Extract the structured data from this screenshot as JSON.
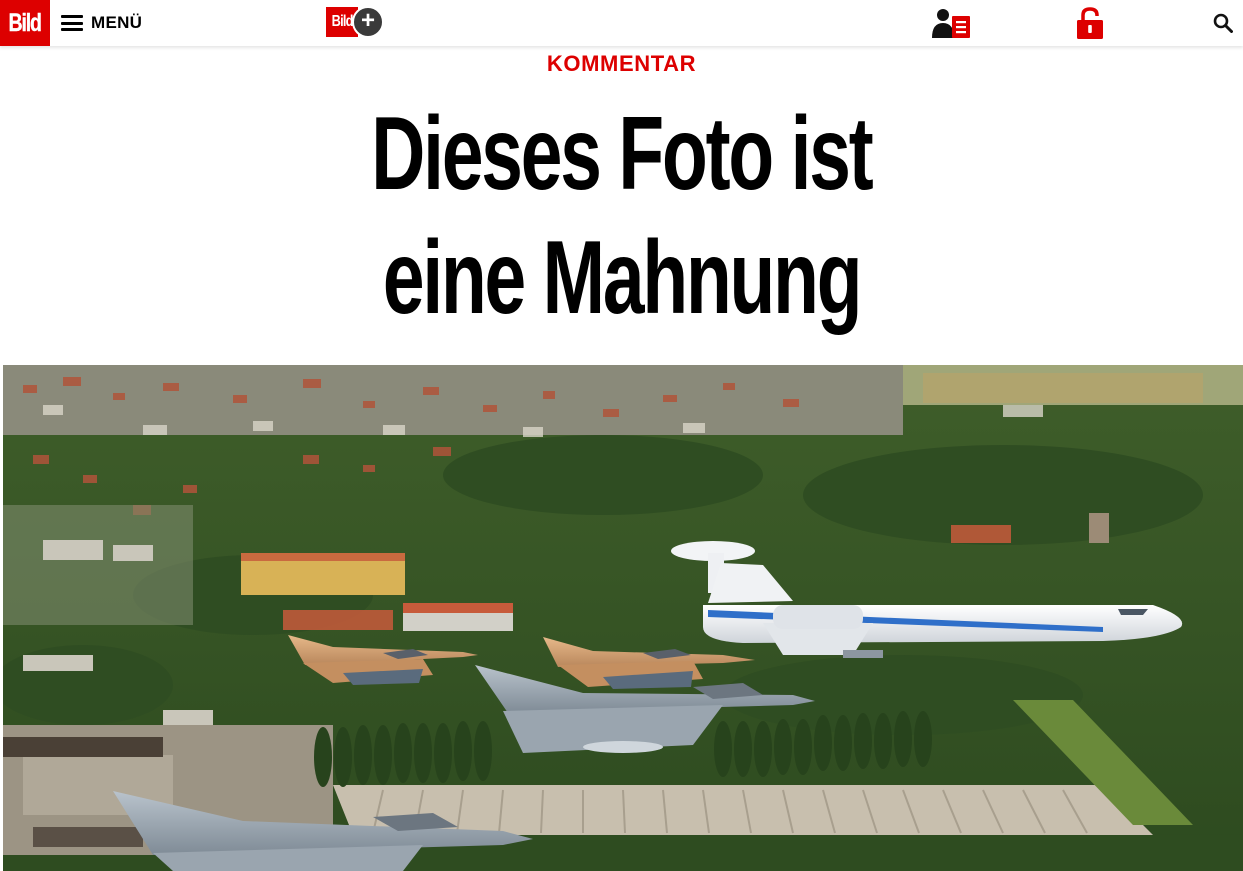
{
  "header": {
    "logo_text": "Bild",
    "menu_label": "MENÜ",
    "bildplus_logo_text": "Bild",
    "icons": [
      "bild-logo-icon",
      "hamburger-menu-icon",
      "bildplus-icon",
      "account-icon",
      "lock-icon",
      "search-icon"
    ]
  },
  "article": {
    "kicker": "KOMMENTAR",
    "headline_line1": "Dieses Foto ist",
    "headline_line2": "eine Mahnung"
  },
  "colors": {
    "brand_red": "#dd0000",
    "headline": "#000000",
    "background": "#ffffff"
  }
}
